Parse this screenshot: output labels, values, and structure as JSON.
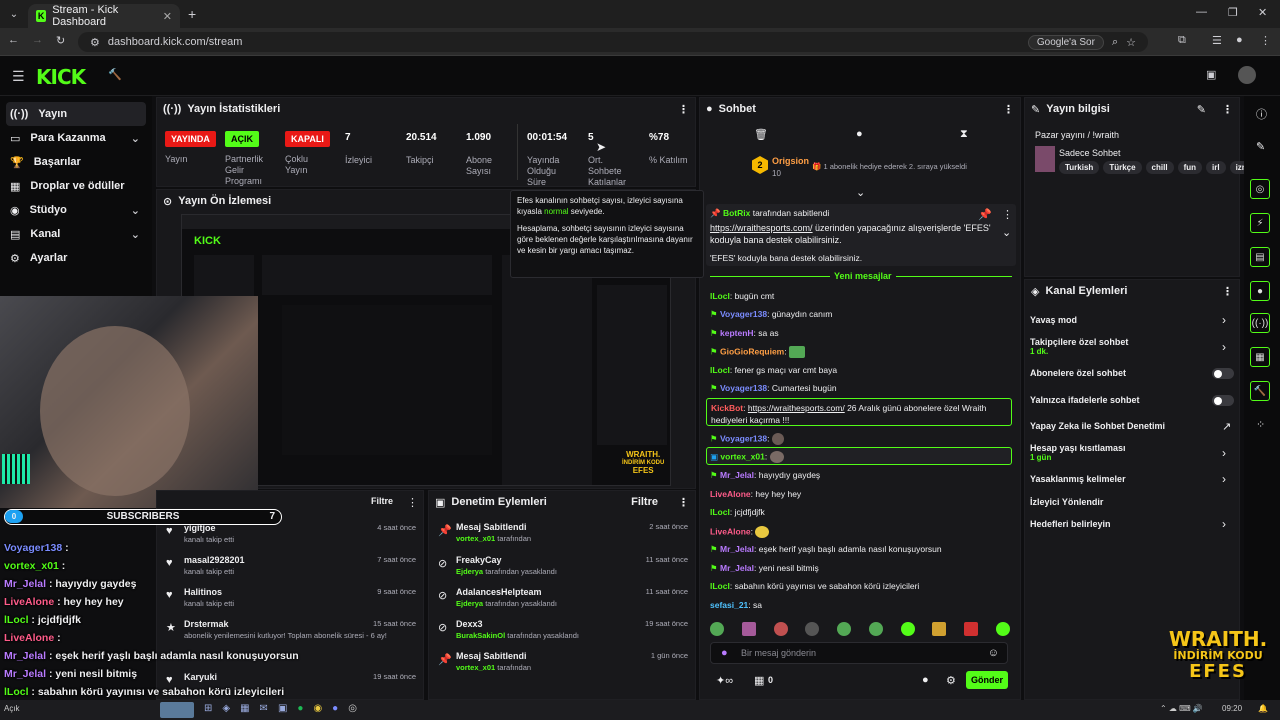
{
  "browser": {
    "tab_title": "Stream - Kick Dashboard",
    "url": "dashboard.kick.com/stream",
    "search_pill": "Google'a Sor"
  },
  "sidebar": {
    "items": [
      {
        "label": "Yayın"
      },
      {
        "label": "Para Kazanma"
      },
      {
        "label": "Başarılar"
      },
      {
        "label": "Droplar ve ödüller"
      },
      {
        "label": "Stüdyo"
      },
      {
        "label": "Kanal"
      },
      {
        "label": "Ayarlar"
      }
    ]
  },
  "stats": {
    "title": "Yayın İstatistikleri",
    "badges": {
      "yayinda": "YAYINDA",
      "acik": "AÇIK",
      "kapali": "KAPALI"
    },
    "labels": {
      "yayin": "Yayın",
      "partner": "Partnerlik Gelir Programı",
      "coklu": "Çoklu Yayın"
    },
    "items": [
      {
        "value": "7",
        "label": "İzleyici"
      },
      {
        "value": "20.514",
        "label": "Takipçi"
      },
      {
        "value": "1.090",
        "label": "Abone Sayısı"
      },
      {
        "value": "00:01:54",
        "label": "Yayında Olduğu Süre"
      },
      {
        "value": "5",
        "label": "Ort. Sohbete Katılanlar"
      },
      {
        "value": "%78",
        "label": "% Katılım"
      }
    ]
  },
  "tooltip": {
    "line1a": "Efes kanalının sohbetçi sayısı, izleyici sayısına kıyasla ",
    "line1b": "normal",
    "line1c": " seviyede.",
    "line2": "Hesaplama, sohbetçi sayısının izleyici sayısına göre beklenen değerle karşılaştırılmasına dayanır ve kesin bir yargı amacı taşımaz."
  },
  "preview": {
    "title": "Yayın Ön İzlemesi",
    "ad_lines": [
      "WRAITH.",
      "İNDİRİM KODU",
      "EFES"
    ]
  },
  "activity": {
    "filter": "Filtre",
    "items": [
      {
        "name": "yigitjoe",
        "sub": "kanalı takip etti",
        "time": "4 saat önce"
      },
      {
        "name": "masal2928201",
        "sub": "kanalı takip etti",
        "time": "7 saat önce"
      },
      {
        "name": "Halitinos",
        "sub": "kanalı takip etti",
        "time": "9 saat önce"
      },
      {
        "name": "Drstermak",
        "sub": "abonelik yenilemesini kutluyor! Toplam abonelik süresi - 6 ay!",
        "time": "15 saat önce"
      },
      {
        "name": "Karyuki",
        "sub": "",
        "time": "19 saat önce"
      }
    ]
  },
  "moderation": {
    "title": "Denetim Eylemleri",
    "filter": "Filtre",
    "items": [
      {
        "name": "Mesaj Sabitlendi",
        "user": "vortex_x01",
        "suffix": " tarafından",
        "time": "2 saat önce"
      },
      {
        "name": "FreakyCay",
        "user": "Ejderya",
        "suffix": " tarafından yasaklandı",
        "time": "11 saat önce"
      },
      {
        "name": "AdalancesHelpteam",
        "user": "Ejderya",
        "suffix": " tarafından yasaklandı",
        "time": "11 saat önce"
      },
      {
        "name": "Dexx3",
        "user": "BurakSakinOl",
        "suffix": " tarafından yasaklandı",
        "time": "19 saat önce"
      },
      {
        "name": "Mesaj Sabitlendi",
        "user": "vortex_x01",
        "suffix": " tarafından",
        "time": "1 gün önce"
      }
    ]
  },
  "chat": {
    "title": "Sohbet",
    "gift_user": "Origsion",
    "gift_count": "10",
    "gift_text": "1 abonelik hediye ederek 2. sıraya yükseldi",
    "pinned_by": "BotRix",
    "pinned_by_suffix": " tarafından sabitlendi",
    "pinned_link": "https://wraithesports.com/",
    "pinned_text": " üzerinden yapacağınız alışverişlerde 'EFES' koduyla bana destek olabilirsiniz.",
    "pinned_text2": "'EFES' koduyla bana destek olabilirsiniz.",
    "new_messages": "Yeni mesajlar",
    "messages": [
      {
        "user": "lLocl",
        "text": ": bugün cmt",
        "color": "#53fc18"
      },
      {
        "user": "Voyager138",
        "text": ": günaydın canım",
        "color": "#7b8cff"
      },
      {
        "user": "keptenH",
        "text": ": sa as",
        "color": "#b97bff"
      },
      {
        "user": "GioGioRequiem",
        "text": ":",
        "color": "#ff9f45"
      },
      {
        "user": "lLocl",
        "text": ": fener gs maçı var cmt baya",
        "color": "#53fc18"
      },
      {
        "user": "Voyager138",
        "text": ": Cumartesi bugün",
        "color": "#7b8cff"
      },
      {
        "user": "Voyager138",
        "text": ":",
        "color": "#7b8cff"
      },
      {
        "user": "vortex_x01",
        "text": ":",
        "color": "#53fc18"
      },
      {
        "user": "Mr_Jelal",
        "text": ": hayıydıy gaydeş",
        "color": "#b97bff"
      },
      {
        "user": "LiveAlone",
        "text": ": hey hey hey",
        "color": "#ff5c8a"
      },
      {
        "user": "lLocl",
        "text": ": jcjdfjdjfk",
        "color": "#53fc18"
      },
      {
        "user": "LiveAlone",
        "text": ":",
        "color": "#ff5c8a"
      },
      {
        "user": "Mr_Jelal",
        "text": ": eşek herif yaşlı başlı adamla nasıl konuşuyorsun",
        "color": "#b97bff"
      },
      {
        "user": "Mr_Jelal",
        "text": ": yeni nesil bitmiş",
        "color": "#b97bff"
      },
      {
        "user": "lLocl",
        "text": ": sabahın körü yayınısı ve sabahon körü izleyicileri",
        "color": "#53fc18"
      },
      {
        "user": "sefasi_21",
        "text": ": sa",
        "color": "#4fc3ff"
      }
    ],
    "botmsg_user": "KickBot",
    "botmsg_link": "https://wraithesports.com/",
    "botmsg_text": " 26 Aralık günü abonelere özel Wraith hediyeleri kaçırma !!!",
    "input_placeholder": "Bir mesaj gönderin",
    "count": "0",
    "send": "Gönder"
  },
  "stream_info": {
    "title": "Yayın bilgisi",
    "stream_title": "Pazar yayını / !wraith",
    "category": "Sadece Sohbet",
    "tags": [
      "Turkish",
      "Türkçe",
      "chill",
      "fun",
      "irl",
      "izm"
    ]
  },
  "channel_actions": {
    "title": "Kanal Eylemleri",
    "items": [
      {
        "label": "Yavaş mod"
      },
      {
        "label": "Takipçilere özel sohbet",
        "sub": "1 dk."
      },
      {
        "label": "Abonelere özel sohbet"
      },
      {
        "label": "Yalnızca ifadelerle sohbet"
      },
      {
        "label": "Yapay Zeka ile Sohbet Denetimi"
      },
      {
        "label": "Hesap yaşı kısıtlaması",
        "sub": "1 gün"
      },
      {
        "label": "Yasaklanmış kelimeler"
      },
      {
        "label": "İzleyici Yönlendir"
      },
      {
        "label": "Hedefleri belirleyin"
      }
    ]
  },
  "overlay": {
    "sub_count_left": "0",
    "sub_label": "SUBSCRIBERS",
    "sub_count_right": "7",
    "lines": [
      {
        "user": "Voyager138",
        "text": " :",
        "color": "#7b8cff"
      },
      {
        "user": "vortex_x01",
        "text": " :",
        "color": "#53fc18"
      },
      {
        "user": "Mr_Jelal",
        "text": " : hayıydıy gaydeş",
        "color": "#b97bff"
      },
      {
        "user": "LiveAlone",
        "text": " : hey hey hey",
        "color": "#ff5c8a"
      },
      {
        "user": "lLocl",
        "text": " : jcjdfjdjfk",
        "color": "#53fc18"
      },
      {
        "user": "LiveAlone",
        "text": " :",
        "color": "#ff5c8a"
      },
      {
        "user": "Mr_Jelal",
        "text": " : eşek herif yaşlı başlı adamla nasıl konuşuyorsun",
        "color": "#b97bff"
      },
      {
        "user": "Mr_Jelal",
        "text": " : yeni nesil bitmiş",
        "color": "#b97bff"
      },
      {
        "user": "lLocl",
        "text": " : sabahın körü yayınısı ve sabahon körü izleyicileri",
        "color": "#53fc18"
      }
    ],
    "ad": [
      "WRAITH.",
      "İNDİRİM KODU",
      "EFES"
    ]
  },
  "taskbar": {
    "clock": "09:20",
    "weather": "Açık"
  }
}
